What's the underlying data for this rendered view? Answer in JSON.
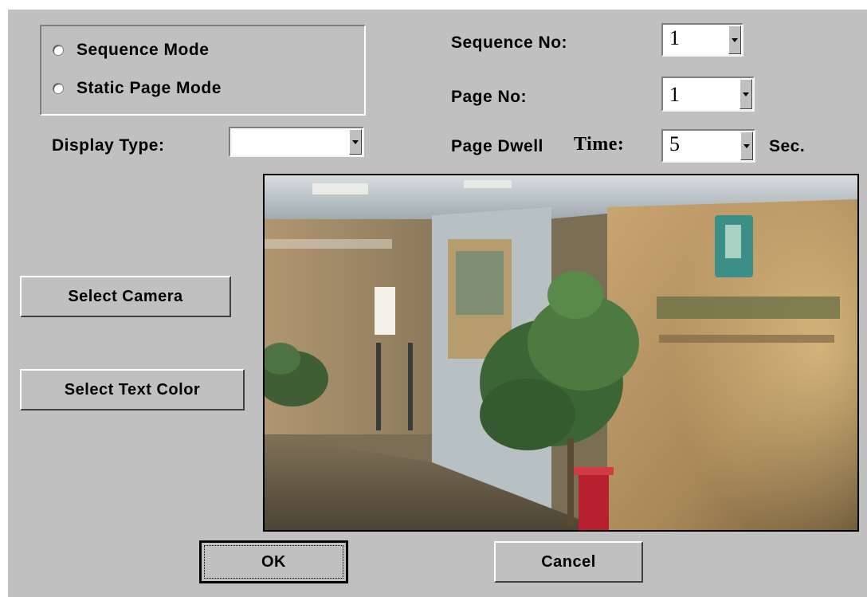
{
  "mode": {
    "options": [
      "Sequence Mode",
      "Static Page Mode"
    ]
  },
  "display_type": {
    "label": "Display Type:",
    "value": ""
  },
  "sequence_no": {
    "label": "Sequence No:",
    "value": "1"
  },
  "page_no": {
    "label": "Page No:",
    "value": "1"
  },
  "page_dwell": {
    "label": "Page Dwell",
    "label2": "Time:",
    "value": "5",
    "unit": "Sec."
  },
  "buttons": {
    "select_camera": "Select Camera",
    "select_text_color": "Select Text Color",
    "ok": "OK",
    "cancel": "Cancel"
  },
  "colors": {
    "dialog_bg": "#c0c0c0",
    "field_bg": "#ffffff"
  },
  "icons": {
    "dropdown": "chevron-down-icon",
    "radio": "radio-icon"
  }
}
